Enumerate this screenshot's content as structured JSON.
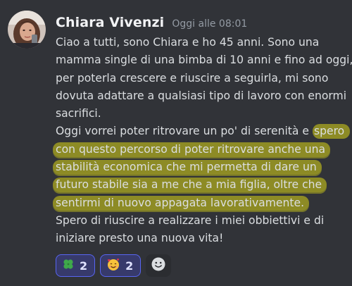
{
  "message": {
    "author": "Chiara Vivenzi",
    "timestamp": "Oggi alle 08:01",
    "lines": [
      "Ciao a tutti, sono Chiara e ho 45 anni. Sono una",
      "mamma single di una bimba di 10 anni e fino ad oggi,",
      "per poterla crescere e riuscire a seguirla, mi sono",
      "dovuta adattare a qualsiasi tipo di lavoro con enormi",
      "sacrifici.",
      "Oggi vorrei poter ritrovare un po' di serenità e ",
      "spero",
      "con questo percorso di poter ritrovare anche una",
      "stabilità economica che mi permetta di dare un",
      "futuro stabile sia a me che a mia figlia, oltre che",
      "sentirmi di nuovo appagata lavorativamente.",
      "Spero di riuscire a realizzare i miei obbiettivi e di",
      "iniziare presto una nuova vita!"
    ]
  },
  "reactions": [
    {
      "emoji": "🍀",
      "count": "2",
      "icon": "four-leaf-clover-icon"
    },
    {
      "emoji": "🥰",
      "count": "2",
      "icon": "smiling-face-with-hearts-icon"
    }
  ],
  "add_reaction_icon": "add-reaction-smiley-icon",
  "colors": {
    "background": "#313338",
    "author": "#f2f3f5",
    "timestamp": "#949ba4",
    "text": "#dbdee1",
    "highlight": "#bab61c",
    "reaction_border": "#5865f2",
    "reaction_bg": "#373a6b"
  }
}
